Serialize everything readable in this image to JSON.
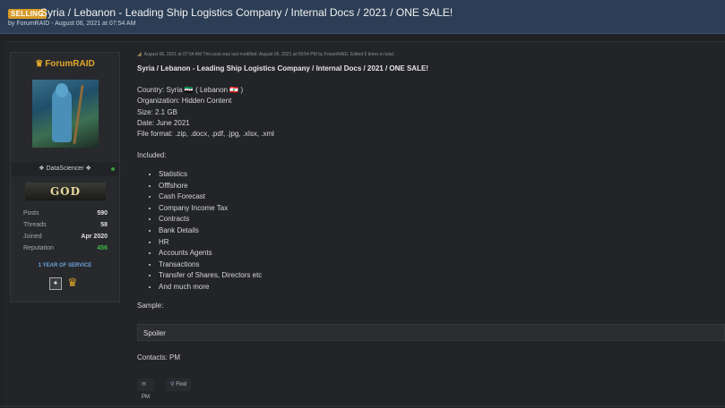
{
  "thread": {
    "badge": "SELLING",
    "title": "Syria / Lebanon - Leading Ship Logistics Company / Internal Docs / 2021 / ONE SALE!",
    "byline": "by ForumRAID - August 06, 2021 at 07:54 AM"
  },
  "user": {
    "name": "ForumRAID",
    "role": "❖ DataSciencer ❖",
    "rank": "GOD",
    "stats": [
      {
        "label": "Posts",
        "value": "590"
      },
      {
        "label": "Threads",
        "value": "58"
      },
      {
        "label": "Joined",
        "value": "Apr 2020"
      },
      {
        "label": "Reputation",
        "value": "456"
      }
    ],
    "service": "1 YEAR OF SERVICE"
  },
  "post": {
    "meta": "August 06, 2021 at 07:54 AM   This post was last modified: August 06, 2021 at 09:54 PM by ForumRAID. Edited 6 times in total.",
    "title": "Syria / Lebanon - Leading Ship Logistics Company / Internal Docs / 2021 / ONE SALE!",
    "country": "Country: Syria 🇸🇾 ( Lebanon 🇱🇧 )",
    "organization": "Organization: Hidden Content",
    "size": "Size: 2.1 GB",
    "date": "Date: June 2021",
    "format": "File format: .zip, .docx, .pdf, .jpg, .xlsx, .xml",
    "included_label": "Included:",
    "included": [
      "Statistics",
      "Offfshore",
      "Cash Forecast",
      "Company Income Tax",
      "Contracts",
      "Bank Details",
      "HR",
      "Accounts Agents",
      "Transactions",
      "Transfer of Shares, Directors etc",
      "And much more"
    ],
    "sample_label": "Sample:",
    "spoiler": "Spoiler",
    "contacts": "Contacts: PM",
    "pm_button": "PM",
    "find_button": "Find"
  },
  "colors": {
    "header_bg": "#2c3e55",
    "username": "#e2a829",
    "reputation": "#3dbb4a",
    "badge": "#d79c2b"
  }
}
